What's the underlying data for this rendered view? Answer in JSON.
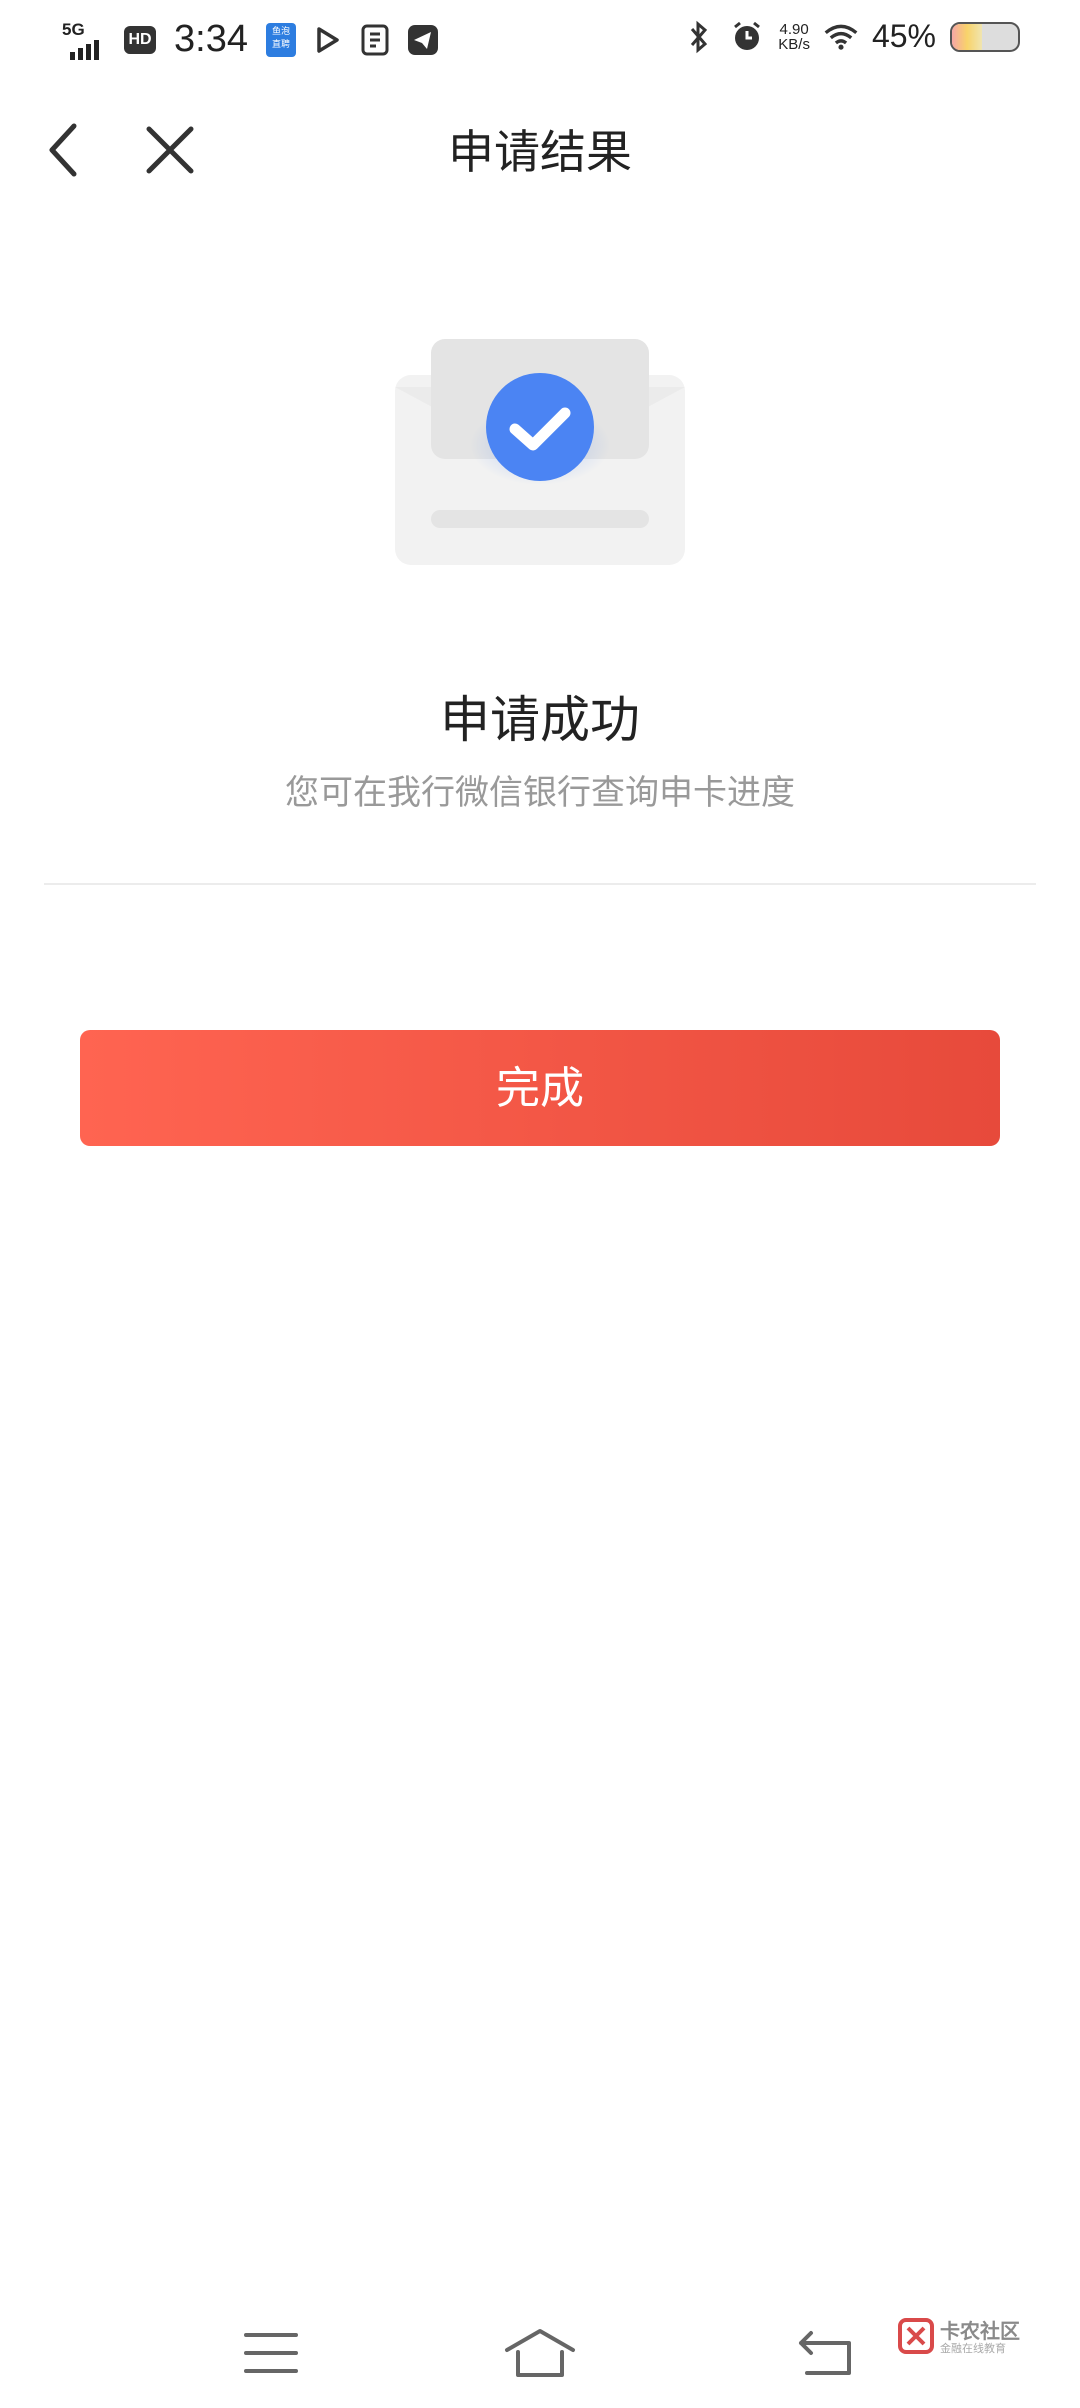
{
  "status_bar": {
    "network": "5G",
    "hd_badge": "HD",
    "time": "3:34",
    "app_badge_line1": "鱼泡",
    "app_badge_line2": "直聘",
    "speed_value": "4.90",
    "speed_unit": "KB/s",
    "battery_percent": "45%",
    "battery_level": 0.45
  },
  "header": {
    "title": "申请结果",
    "back_icon": "chevron-left-icon",
    "close_icon": "close-icon"
  },
  "result": {
    "icon": "success-envelope-check-icon",
    "title": "申请成功",
    "description": "您可在我行微信银行查询申卡进度"
  },
  "actions": {
    "done_label": "完成"
  },
  "nav_bar": {
    "menu_icon": "menu-icon",
    "home_icon": "home-icon",
    "back_icon": "back-icon"
  },
  "watermark": {
    "name": "卡农社区",
    "tagline": "金融在线教育"
  },
  "colors": {
    "accent": "#ef5242",
    "check_blue": "#4b84f3"
  }
}
